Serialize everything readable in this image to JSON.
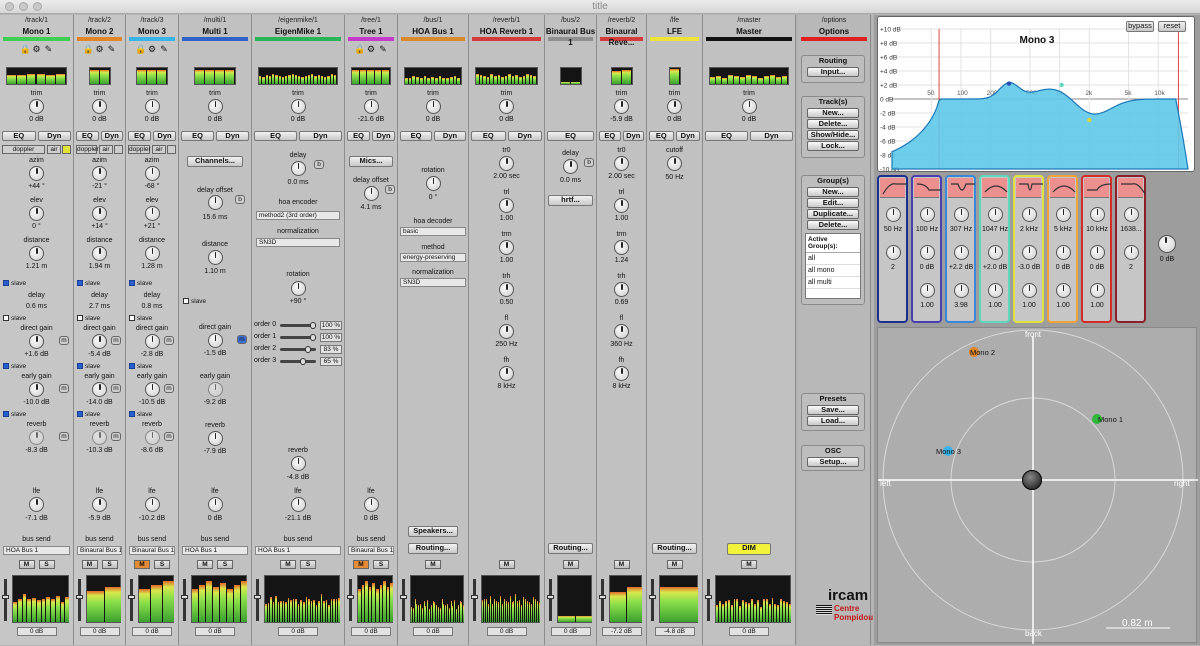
{
  "window": {
    "title": "title"
  },
  "strips": [
    {
      "path": "/track/1",
      "name": "Mono 1",
      "color": "#3ccf52",
      "trim": "0 dB",
      "eq": "EQ",
      "dyn": "Dyn",
      "doppler": "doppler",
      "air": "air",
      "azim": "azim",
      "azim_val": "+44 °",
      "elev": "elev",
      "elev_val": "0 °",
      "distance": "distance",
      "distance_val": "1.21 m",
      "slave": "slave",
      "delay": "delay",
      "delay_val": "0.6 ms",
      "direct": "direct gain",
      "direct_val": "+1.6 dB",
      "early": "early gain",
      "early_val": "-10.0 dB",
      "reverb": "reverb",
      "reverb_val": "-8.3 dB",
      "lfe": "lfe",
      "lfe_val": "-7.1 dB",
      "bussend": "bus send",
      "bus": "HOA Bus 1",
      "m": "M",
      "s": "S",
      "meter_db": "0 dB",
      "m_btn": "m"
    },
    {
      "path": "/track/2",
      "name": "Mono 2",
      "color": "#e0852a",
      "trim": "0 dB",
      "eq": "EQ",
      "dyn": "Dyn",
      "doppler": "doppler",
      "air": "air",
      "azim": "azim",
      "azim_val": "-21 °",
      "elev": "elev",
      "elev_val": "+14 °",
      "distance": "distance",
      "distance_val": "1.94 m",
      "slave": "slave",
      "delay": "delay",
      "delay_val": "2.7 ms",
      "direct": "direct gain",
      "direct_val": "-5.4 dB",
      "early": "early gain",
      "early_val": "-14.0 dB",
      "reverb": "reverb",
      "reverb_val": "-10.3 dB",
      "lfe": "lfe",
      "lfe_val": "-5.9 dB",
      "bussend": "bus send",
      "bus": "Binaural Bus 1",
      "m": "M",
      "s": "S",
      "meter_db": "0 dB",
      "m_btn": "m"
    },
    {
      "path": "/track/3",
      "name": "Mono 3",
      "color": "#38b5e8",
      "trim": "0 dB",
      "eq": "EQ",
      "dyn": "Dyn",
      "doppler": "doppler",
      "air": "air",
      "azim": "azim",
      "azim_val": "-68 °",
      "elev": "elev",
      "elev_val": "+21 °",
      "distance": "distance",
      "distance_val": "1.28 m",
      "slave": "slave",
      "delay": "delay",
      "delay_val": "0.8 ms",
      "direct": "direct gain",
      "direct_val": "-2.8 dB",
      "early": "early gain",
      "early_val": "-10.5 dB",
      "reverb": "reverb",
      "reverb_val": "-8.6 dB",
      "lfe": "lfe",
      "lfe_val": "-10.2 dB",
      "bussend": "bus send",
      "bus": "Binaural Bus 1",
      "m": "M",
      "s": "S",
      "meter_db": "0 dB",
      "m_btn": "m"
    },
    {
      "path": "/multi/1",
      "name": "Multi 1",
      "color": "#2f62c8",
      "trim": "0 dB",
      "eq": "EQ",
      "dyn": "Dyn",
      "channels": "Channels...",
      "delay_offset": "delay offset",
      "delay_offset_val": "15.6 ms",
      "b": "b",
      "distance": "distance",
      "distance_val": "1.10 m",
      "slave": "slave",
      "direct": "direct gain",
      "direct_val": "-1.5 dB",
      "early": "early gain",
      "early_val": "-9.2 dB",
      "reverb": "reverb",
      "reverb_val": "-7.9 dB",
      "lfe": "lfe",
      "lfe_val": "0 dB",
      "bussend": "bus send",
      "bus": "HOA Bus 1",
      "m": "M",
      "s": "S",
      "meter_db": "0 dB",
      "m_btn": "m"
    },
    {
      "path": "/eigenmike/1",
      "name": "EigenMike 1",
      "color": "#28b458",
      "trim": "0 dB",
      "eq": "EQ",
      "dyn": "Dyn",
      "delay": "delay",
      "delay_val": "0.0 ms",
      "b": "b",
      "hoa_encoder": "hoa encoder",
      "encoder_sel": "method2 (3rd order)",
      "normalization": "normalization",
      "norm_sel": "SN3D",
      "rotation": "rotation",
      "rotation_val": "+90 °",
      "orders": [
        {
          "label": "order 0",
          "val": "100 %"
        },
        {
          "label": "order 1",
          "val": "100 %"
        },
        {
          "label": "order 2",
          "val": "83 %"
        },
        {
          "label": "order 3",
          "val": "65 %"
        }
      ],
      "reverb": "reverb",
      "reverb_val": "-4.8 dB",
      "lfe": "lfe",
      "lfe_val": "-21.1 dB",
      "bussend": "bus send",
      "bus": "HOA Bus 1",
      "m": "M",
      "s": "S",
      "meter_db": "0 dB"
    },
    {
      "path": "/tree/1",
      "name": "Tree 1",
      "color": "#c53ac8",
      "trim": "-21.6 dB",
      "eq": "EQ",
      "dyn": "Dyn",
      "mics": "Mics...",
      "delay_offset": "delay offset",
      "delay_offset_val": "4.1 ms",
      "b": "b",
      "lfe": "lfe",
      "lfe_val": "0 dB",
      "bussend": "bus send",
      "bus": "Binaural Bus 1",
      "m": "M",
      "s": "S",
      "meter_db": "0 dB"
    },
    {
      "path": "/bus/1",
      "name": "HOA Bus 1",
      "color": "#d98a2e",
      "trim": "0 dB",
      "eq": "EQ",
      "dyn": "Dyn",
      "rotation": "rotation",
      "rotation_val": "0 °",
      "hoa_decoder": "hoa decoder",
      "decoder_sel": "basic",
      "method": "method",
      "method_sel": "energy-preserving",
      "normalization": "normalization",
      "norm_sel": "SN3D",
      "speakers": "Speakers...",
      "routing": "Routing...",
      "m": "M",
      "meter_db": "0 dB"
    },
    {
      "path": "/reverb/1",
      "name": "HOA Reverb 1",
      "color": "#d43a3a",
      "trim": "0 dB",
      "eq": "EQ",
      "dyn": "Dyn",
      "tr0": "tr0",
      "tr0_val": "2.00 sec",
      "trl": "trl",
      "trl_val": "1.00",
      "trm": "trm",
      "trm_val": "1.00",
      "trh": "trh",
      "trh_val": "0.50",
      "fl": "fl",
      "fl_val": "250 Hz",
      "fh": "fh",
      "fh_val": "8 kHz",
      "m": "M",
      "meter_db": "0 dB"
    },
    {
      "path": "/bus/2",
      "name": "Binaural Bus 1",
      "color": "#8f8f8f",
      "eq": "EQ",
      "delay": "delay",
      "delay_val": "0.0 ms",
      "b": "b",
      "hrtf": "hrtf...",
      "routing": "Routing...",
      "m": "M",
      "meter_db": "0 dB"
    },
    {
      "path": "/reverb/2",
      "name": "Binaural Reve...",
      "color": "#d43a3a",
      "trim": "-5.9 dB",
      "eq": "EQ",
      "dyn": "Dyn",
      "tr0": "tr0",
      "tr0_val": "2.00 sec",
      "trl": "trl",
      "trl_val": "1.00",
      "trm": "trm",
      "trm_val": "1.24",
      "trh": "trh",
      "trh_val": "0.69",
      "fl": "fl",
      "fl_val": "360 Hz",
      "fh": "fh",
      "fh_val": "8 kHz",
      "m": "M",
      "meter_db": "-7.2 dB"
    },
    {
      "path": "/lfe",
      "name": "LFE",
      "color": "#efe23a",
      "trim": "0 dB",
      "eq": "EQ",
      "dyn": "Dyn",
      "cutoff": "cutoff",
      "cutoff_val": "50 Hz",
      "routing": "Routing...",
      "m": "M",
      "meter_db": "-4.8 dB"
    },
    {
      "path": "/master",
      "name": "Master",
      "color": "#111111",
      "trim": "0 dB",
      "eq": "EQ",
      "dyn": "Dyn",
      "dim": "DIM",
      "m": "M",
      "meter_db": "0 dB"
    }
  ],
  "options": {
    "path": "/options",
    "title": "Options",
    "color": "#e02020",
    "routing_title": "Routing",
    "input": "Input...",
    "tracks_title": "Track(s)",
    "new": "New...",
    "delete": "Delete...",
    "show_hide": "Show/Hide...",
    "lock": "Lock...",
    "groups_title": "Group(s)",
    "g_new": "New...",
    "g_edit": "Edit...",
    "g_duplicate": "Duplicate...",
    "g_delete": "Delete...",
    "active_groups": "Active Group(s):",
    "groups": [
      "all",
      "all mono",
      "all multi"
    ],
    "presets_title": "Presets",
    "save": "Save...",
    "load": "Load...",
    "osc_title": "OSC",
    "setup": "Setup...",
    "logo_top": "ircam",
    "logo_bottom1": "Centre",
    "logo_bottom2": "Pompidou"
  },
  "eq": {
    "title": "Mono 3",
    "bypass": "bypass",
    "reset": "reset",
    "db_labels": [
      "+10 dB",
      "+8 dB",
      "+6 dB",
      "+4 dB",
      "+2 dB",
      "0 dB",
      "-2 dB",
      "-4 dB",
      "-6 dB",
      "-8 dB",
      "-10 dB"
    ],
    "freq_labels": [
      "50",
      "100",
      "200",
      "500",
      "1k",
      "2k",
      "5k",
      "10k"
    ],
    "bands": [
      {
        "freq": "50 Hz",
        "gain": "2",
        "q": "",
        "color": "#1c2f8f"
      },
      {
        "freq": "100 Hz",
        "gain": "0 dB",
        "q": "1.00",
        "color": "#4a3fb0"
      },
      {
        "freq": "307 Hz",
        "gain": "+2.2 dB",
        "q": "3.98",
        "color": "#3a86d9"
      },
      {
        "freq": "1047 Hz",
        "gain": "+2.0 dB",
        "q": "1.00",
        "color": "#5fd7bd"
      },
      {
        "freq": "2 kHz",
        "gain": "-3.0 dB",
        "q": "1.00",
        "color": "#e0e23c"
      },
      {
        "freq": "5 kHz",
        "gain": "0 dB",
        "q": "1.00",
        "color": "#efa43a"
      },
      {
        "freq": "10 kHz",
        "gain": "0 dB",
        "q": "1.00",
        "color": "#d42a2a"
      },
      {
        "freq": "1638...",
        "gain": "2",
        "q": "",
        "color": "#8a1f2a"
      }
    ],
    "master_gain": "0 dB"
  },
  "space": {
    "front": "front",
    "back": "back",
    "left": "left",
    "right": "right",
    "scale": "0.82 m",
    "sources": [
      {
        "name": "Mono 2",
        "color": "#e0852a"
      },
      {
        "name": "Mono 1",
        "color": "#2fb83a"
      },
      {
        "name": "Mono 3",
        "color": "#38b5e8"
      }
    ]
  }
}
